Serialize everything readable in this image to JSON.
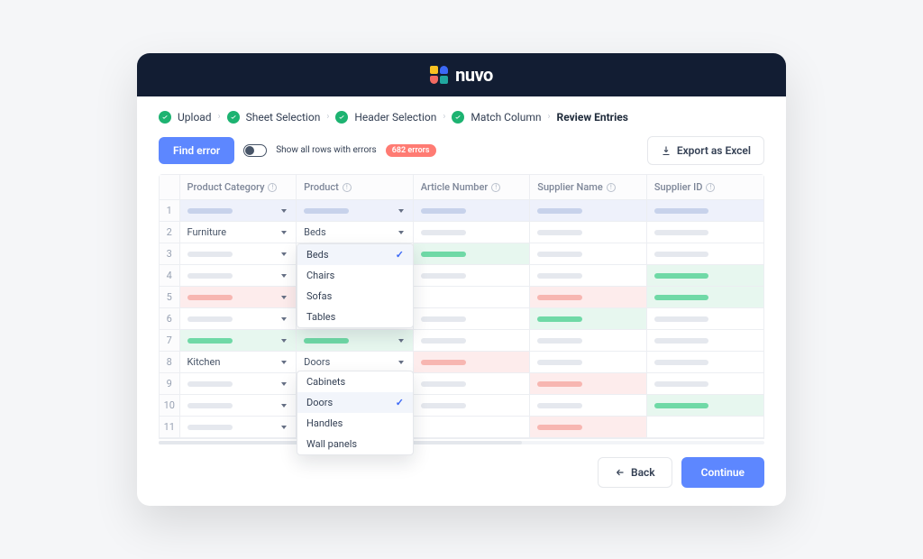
{
  "brand": "nuvo",
  "stepper": {
    "completed": [
      "Upload",
      "Sheet Selection",
      "Header Selection",
      "Match Column"
    ],
    "current": "Review Entries"
  },
  "toolbar": {
    "find_error": "Find error",
    "toggle_label": "Show all rows with errors",
    "error_badge": "682 errors",
    "export_label": "Export as Excel"
  },
  "columns": [
    "Product Category",
    "Product",
    "Article Number",
    "Supplier Name",
    "Supplier ID"
  ],
  "rows": [
    {
      "n": 1,
      "cat": {
        "kind": "skel",
        "sk": "blue",
        "bg": "blue",
        "dd": true
      },
      "prod": {
        "kind": "skel",
        "sk": "blue",
        "bg": "blue",
        "dd": true
      },
      "art": {
        "kind": "skel",
        "sk": "blue",
        "bg": "blue"
      },
      "sup": {
        "kind": "skel",
        "sk": "blue",
        "bg": "blue"
      },
      "sid": {
        "kind": "skel",
        "sk": "blue",
        "bg": "blue"
      }
    },
    {
      "n": 2,
      "cat": {
        "kind": "text",
        "val": "Furniture",
        "dd": true
      },
      "prod": {
        "kind": "text",
        "val": "Beds",
        "dd": true
      },
      "art": {
        "kind": "skel",
        "sk": "grey"
      },
      "sup": {
        "kind": "skel",
        "sk": "grey"
      },
      "sid": {
        "kind": "skel",
        "sk": "grey"
      }
    },
    {
      "n": 3,
      "cat": {
        "kind": "skel",
        "sk": "grey",
        "dd": true
      },
      "prod": {
        "kind": "dropdown"
      },
      "art": {
        "kind": "skel",
        "sk": "green",
        "bg": "green"
      },
      "sup": {
        "kind": "skel",
        "sk": "grey"
      },
      "sid": {
        "kind": "skel",
        "sk": "grey"
      }
    },
    {
      "n": 4,
      "cat": {
        "kind": "skel",
        "sk": "grey",
        "dd": true
      },
      "prod": {
        "kind": "dropdown"
      },
      "art": {
        "kind": "skel",
        "sk": "grey"
      },
      "sup": {
        "kind": "skel",
        "sk": "grey"
      },
      "sid": {
        "kind": "skel",
        "sk": "green",
        "bg": "green"
      }
    },
    {
      "n": 5,
      "cat": {
        "kind": "skel",
        "sk": "red",
        "bg": "red",
        "dd": true
      },
      "prod": {
        "kind": "dropdown"
      },
      "art": {
        "kind": "empty"
      },
      "sup": {
        "kind": "skel",
        "sk": "red",
        "bg": "red"
      },
      "sid": {
        "kind": "skel",
        "sk": "green",
        "bg": "green"
      }
    },
    {
      "n": 6,
      "cat": {
        "kind": "skel",
        "sk": "grey",
        "dd": true
      },
      "prod": {
        "kind": "dropdown"
      },
      "art": {
        "kind": "skel",
        "sk": "grey"
      },
      "sup": {
        "kind": "skel",
        "sk": "green",
        "bg": "green"
      },
      "sid": {
        "kind": "skel",
        "sk": "grey"
      }
    },
    {
      "n": 7,
      "cat": {
        "kind": "skel",
        "sk": "green",
        "bg": "green",
        "dd": true
      },
      "prod": {
        "kind": "skel",
        "sk": "green",
        "bg": "green",
        "dd": true
      },
      "art": {
        "kind": "skel",
        "sk": "grey"
      },
      "sup": {
        "kind": "skel",
        "sk": "grey"
      },
      "sid": {
        "kind": "skel",
        "sk": "grey"
      }
    },
    {
      "n": 8,
      "cat": {
        "kind": "text",
        "val": "Kitchen",
        "dd": true
      },
      "prod": {
        "kind": "text",
        "val": "Doors",
        "dd": true
      },
      "art": {
        "kind": "skel",
        "sk": "red",
        "bg": "red"
      },
      "sup": {
        "kind": "skel",
        "sk": "grey"
      },
      "sid": {
        "kind": "skel",
        "sk": "grey"
      }
    },
    {
      "n": 9,
      "cat": {
        "kind": "skel",
        "sk": "grey",
        "dd": true
      },
      "prod": {
        "kind": "dropdown"
      },
      "art": {
        "kind": "skel",
        "sk": "grey"
      },
      "sup": {
        "kind": "skel",
        "sk": "red",
        "bg": "red"
      },
      "sid": {
        "kind": "skel",
        "sk": "grey"
      }
    },
    {
      "n": 10,
      "cat": {
        "kind": "skel",
        "sk": "grey",
        "dd": true
      },
      "prod": {
        "kind": "dropdown"
      },
      "art": {
        "kind": "skel",
        "sk": "grey"
      },
      "sup": {
        "kind": "skel",
        "sk": "grey"
      },
      "sid": {
        "kind": "skel",
        "sk": "green",
        "bg": "green"
      }
    },
    {
      "n": 11,
      "cat": {
        "kind": "skel",
        "sk": "grey",
        "dd": true
      },
      "prod": {
        "kind": "dropdown"
      },
      "art": {
        "kind": "empty"
      },
      "sup": {
        "kind": "skel",
        "sk": "red",
        "bg": "red"
      },
      "sid": {
        "kind": "empty"
      }
    }
  ],
  "dropdown1": {
    "options": [
      "Beds",
      "Chairs",
      "Sofas",
      "Tables"
    ],
    "selected": "Beds"
  },
  "dropdown2": {
    "options": [
      "Cabinets",
      "Doors",
      "Handles",
      "Wall panels"
    ],
    "selected": "Doors"
  },
  "footer": {
    "back": "Back",
    "continue": "Continue"
  }
}
